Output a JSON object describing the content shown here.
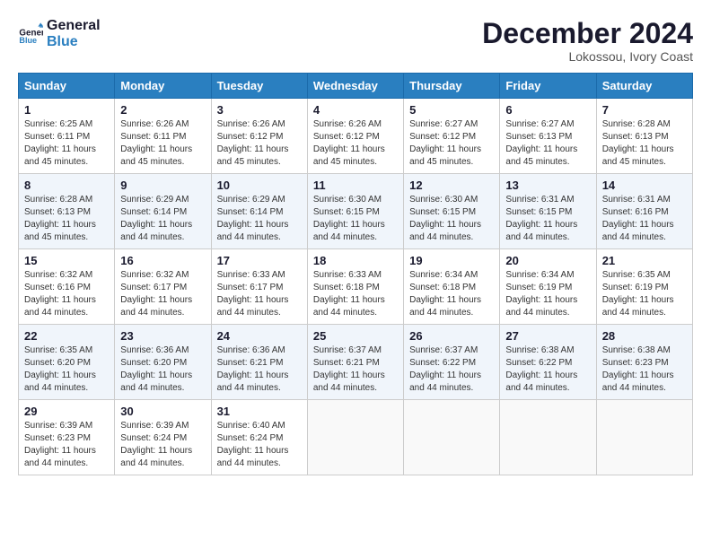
{
  "header": {
    "logo_line1": "General",
    "logo_line2": "Blue",
    "month_year": "December 2024",
    "location": "Lokossou, Ivory Coast"
  },
  "days_of_week": [
    "Sunday",
    "Monday",
    "Tuesday",
    "Wednesday",
    "Thursday",
    "Friday",
    "Saturday"
  ],
  "weeks": [
    [
      {
        "day": "1",
        "sunrise": "6:25 AM",
        "sunset": "6:11 PM",
        "daylight": "11 hours and 45 minutes."
      },
      {
        "day": "2",
        "sunrise": "6:26 AM",
        "sunset": "6:11 PM",
        "daylight": "11 hours and 45 minutes."
      },
      {
        "day": "3",
        "sunrise": "6:26 AM",
        "sunset": "6:12 PM",
        "daylight": "11 hours and 45 minutes."
      },
      {
        "day": "4",
        "sunrise": "6:26 AM",
        "sunset": "6:12 PM",
        "daylight": "11 hours and 45 minutes."
      },
      {
        "day": "5",
        "sunrise": "6:27 AM",
        "sunset": "6:12 PM",
        "daylight": "11 hours and 45 minutes."
      },
      {
        "day": "6",
        "sunrise": "6:27 AM",
        "sunset": "6:13 PM",
        "daylight": "11 hours and 45 minutes."
      },
      {
        "day": "7",
        "sunrise": "6:28 AM",
        "sunset": "6:13 PM",
        "daylight": "11 hours and 45 minutes."
      }
    ],
    [
      {
        "day": "8",
        "sunrise": "6:28 AM",
        "sunset": "6:13 PM",
        "daylight": "11 hours and 45 minutes."
      },
      {
        "day": "9",
        "sunrise": "6:29 AM",
        "sunset": "6:14 PM",
        "daylight": "11 hours and 44 minutes."
      },
      {
        "day": "10",
        "sunrise": "6:29 AM",
        "sunset": "6:14 PM",
        "daylight": "11 hours and 44 minutes."
      },
      {
        "day": "11",
        "sunrise": "6:30 AM",
        "sunset": "6:15 PM",
        "daylight": "11 hours and 44 minutes."
      },
      {
        "day": "12",
        "sunrise": "6:30 AM",
        "sunset": "6:15 PM",
        "daylight": "11 hours and 44 minutes."
      },
      {
        "day": "13",
        "sunrise": "6:31 AM",
        "sunset": "6:15 PM",
        "daylight": "11 hours and 44 minutes."
      },
      {
        "day": "14",
        "sunrise": "6:31 AM",
        "sunset": "6:16 PM",
        "daylight": "11 hours and 44 minutes."
      }
    ],
    [
      {
        "day": "15",
        "sunrise": "6:32 AM",
        "sunset": "6:16 PM",
        "daylight": "11 hours and 44 minutes."
      },
      {
        "day": "16",
        "sunrise": "6:32 AM",
        "sunset": "6:17 PM",
        "daylight": "11 hours and 44 minutes."
      },
      {
        "day": "17",
        "sunrise": "6:33 AM",
        "sunset": "6:17 PM",
        "daylight": "11 hours and 44 minutes."
      },
      {
        "day": "18",
        "sunrise": "6:33 AM",
        "sunset": "6:18 PM",
        "daylight": "11 hours and 44 minutes."
      },
      {
        "day": "19",
        "sunrise": "6:34 AM",
        "sunset": "6:18 PM",
        "daylight": "11 hours and 44 minutes."
      },
      {
        "day": "20",
        "sunrise": "6:34 AM",
        "sunset": "6:19 PM",
        "daylight": "11 hours and 44 minutes."
      },
      {
        "day": "21",
        "sunrise": "6:35 AM",
        "sunset": "6:19 PM",
        "daylight": "11 hours and 44 minutes."
      }
    ],
    [
      {
        "day": "22",
        "sunrise": "6:35 AM",
        "sunset": "6:20 PM",
        "daylight": "11 hours and 44 minutes."
      },
      {
        "day": "23",
        "sunrise": "6:36 AM",
        "sunset": "6:20 PM",
        "daylight": "11 hours and 44 minutes."
      },
      {
        "day": "24",
        "sunrise": "6:36 AM",
        "sunset": "6:21 PM",
        "daylight": "11 hours and 44 minutes."
      },
      {
        "day": "25",
        "sunrise": "6:37 AM",
        "sunset": "6:21 PM",
        "daylight": "11 hours and 44 minutes."
      },
      {
        "day": "26",
        "sunrise": "6:37 AM",
        "sunset": "6:22 PM",
        "daylight": "11 hours and 44 minutes."
      },
      {
        "day": "27",
        "sunrise": "6:38 AM",
        "sunset": "6:22 PM",
        "daylight": "11 hours and 44 minutes."
      },
      {
        "day": "28",
        "sunrise": "6:38 AM",
        "sunset": "6:23 PM",
        "daylight": "11 hours and 44 minutes."
      }
    ],
    [
      {
        "day": "29",
        "sunrise": "6:39 AM",
        "sunset": "6:23 PM",
        "daylight": "11 hours and 44 minutes."
      },
      {
        "day": "30",
        "sunrise": "6:39 AM",
        "sunset": "6:24 PM",
        "daylight": "11 hours and 44 minutes."
      },
      {
        "day": "31",
        "sunrise": "6:40 AM",
        "sunset": "6:24 PM",
        "daylight": "11 hours and 44 minutes."
      },
      null,
      null,
      null,
      null
    ]
  ],
  "labels": {
    "sunrise": "Sunrise:",
    "sunset": "Sunset:",
    "daylight": "Daylight:"
  }
}
